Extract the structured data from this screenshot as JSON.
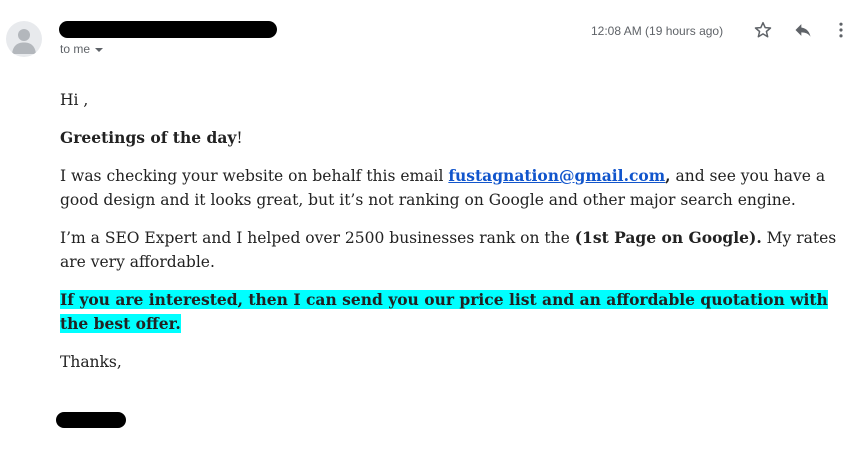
{
  "header": {
    "to_label": "to me",
    "timestamp": "12:08 AM (19 hours ago)",
    "icons": {
      "avatar": "person-avatar-icon",
      "dropdown": "chevron-down-icon",
      "star": "star-icon",
      "reply": "reply-icon",
      "more": "more-vert-icon"
    }
  },
  "message": {
    "salutation": "Hi  ,",
    "greeting_bold": "Greetings of the day",
    "greeting_end": "!",
    "para1_start": "I was checking your website on behalf this email ",
    "para1_link": "fustagnation@gmail.com",
    "para1_comma": ",",
    "para1_end": " and see you have a good design and it looks great, but it’s not ranking on Google and other major search engine.",
    "para2_start": "I’m a SEO Expert and I helped over 2500 businesses rank on the ",
    "para2_bold": "(1st Page on Google).",
    "para2_end": " My rates are very affordable.",
    "highlight": "If you are interested, then I can send you our price list and an affordable quotation with the best offer.",
    "closing": "Thanks,"
  },
  "colors": {
    "highlight": "#00ffff",
    "link": "#1155cc",
    "muted": "#5f6368"
  }
}
